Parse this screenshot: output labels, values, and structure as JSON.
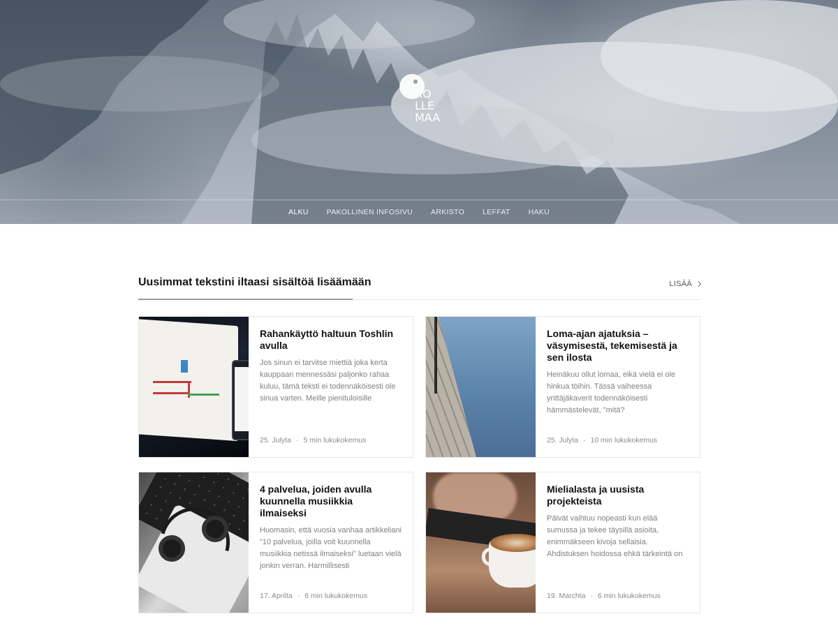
{
  "logo": {
    "letters": [
      "RO",
      "LLE",
      "MAA"
    ]
  },
  "nav": {
    "items": [
      {
        "label": "ALKU",
        "active": true
      },
      {
        "label": "PAKOLLINEN INFOSIVU",
        "active": false
      },
      {
        "label": "ARKISTO",
        "active": false
      },
      {
        "label": "LEFFAT",
        "active": false
      },
      {
        "label": "HAKU",
        "active": false
      }
    ]
  },
  "section": {
    "title": "Uusimmat tekstini iltaasi sisältöä lisäämään",
    "more_label": "LISÄÄ"
  },
  "posts": [
    {
      "title": "Rahankäyttö haltuun Toshlin avulla",
      "excerpt": "Jos sinun ei tarvitse miettiä joka kerta kauppaan mennessäsi paljonko rahaa kuluu, tämä teksti ei todennäköisesti ole sinua varten. Meille pienituloisille",
      "date": "25. Julyta",
      "read_time": "5 min lukukokemus",
      "image": "budget-app-tablet-photo"
    },
    {
      "title": "Loma-ajan ajatuksia – väsymisestä, tekemisestä ja sen ilosta",
      "excerpt": "Heinäkuu ollut lomaa, eikä vielä ei ole hinkua töihin. Tässä vaiheessa yrittäjäkaverit todennäköisesti hämmästelevät, \"mitä?",
      "date": "25. Julyta",
      "read_time": "10 min lukukokemus",
      "image": "pier-water-photo"
    },
    {
      "title": "4 palvelua, joiden avulla kuunnella musiikkia ilmaiseksi",
      "excerpt": "Huomasin, että vuosia vanhaa artikkeliani \"10 palvelua, joilla voit kuunnella musiikkia netissä ilmaiseksi\" luetaan vielä jonkin verran. Harmillisesti",
      "date": "17. Aprilta",
      "read_time": "6 min lukukokemus",
      "image": "headphones-laptop-photo"
    },
    {
      "title": "Mielialasta ja uusista projekteista",
      "excerpt": "Päivät vaihtuu nopeasti kun elää sumussa ja tekee täysillä asioita, enimmäkseen kivoja sellaisia. Ahdistuksen hoidossa ehkä tärkeintä on",
      "date": "19. Marchta",
      "read_time": "6 min lukukokemus",
      "image": "coffee-cup-photo"
    }
  ],
  "meta_separator": "·"
}
